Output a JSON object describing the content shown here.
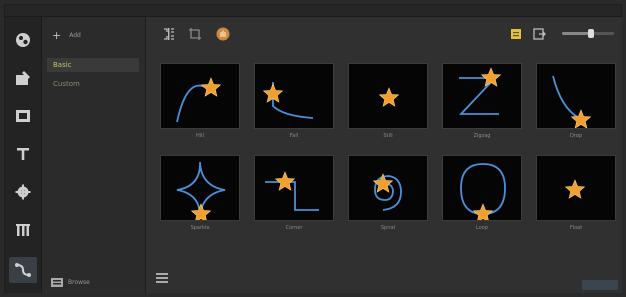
{
  "window": {
    "title": ""
  },
  "rail": {
    "items": [
      {
        "icon": "gallery-icon"
      },
      {
        "icon": "image-edit-icon"
      },
      {
        "icon": "film-icon"
      },
      {
        "icon": "text-icon"
      },
      {
        "icon": "settings-cog-icon"
      },
      {
        "icon": "transition-icon"
      },
      {
        "icon": "motion-path-icon",
        "active": true
      }
    ]
  },
  "categories": {
    "add_symbol": "+",
    "add_label": "Add",
    "items": [
      {
        "label": "Basic",
        "selected": true
      },
      {
        "label": "Custom",
        "selected": false
      }
    ],
    "bottom_label": "Browse"
  },
  "toolbar": {
    "icons": [
      "grid-view-icon",
      "crop-icon",
      "hand-icon"
    ],
    "right_icons": [
      "notes-icon",
      "export-icon"
    ],
    "zoom_level": 0.55
  },
  "accent": "#4a90d9",
  "star_color": "#f0a030",
  "paths": [
    {
      "caption": "Hill",
      "shape": "arc"
    },
    {
      "caption": "Fall",
      "shape": "l-curve"
    },
    {
      "caption": "Still",
      "shape": "none"
    },
    {
      "caption": "Zigzag",
      "shape": "z"
    },
    {
      "caption": "Drop",
      "shape": "drop"
    },
    {
      "caption": "Sparkle",
      "shape": "sparkle"
    },
    {
      "caption": "Corner",
      "shape": "corner"
    },
    {
      "caption": "Spiral",
      "shape": "spiral"
    },
    {
      "caption": "Loop",
      "shape": "oval"
    },
    {
      "caption": "Float",
      "shape": "float"
    }
  ]
}
